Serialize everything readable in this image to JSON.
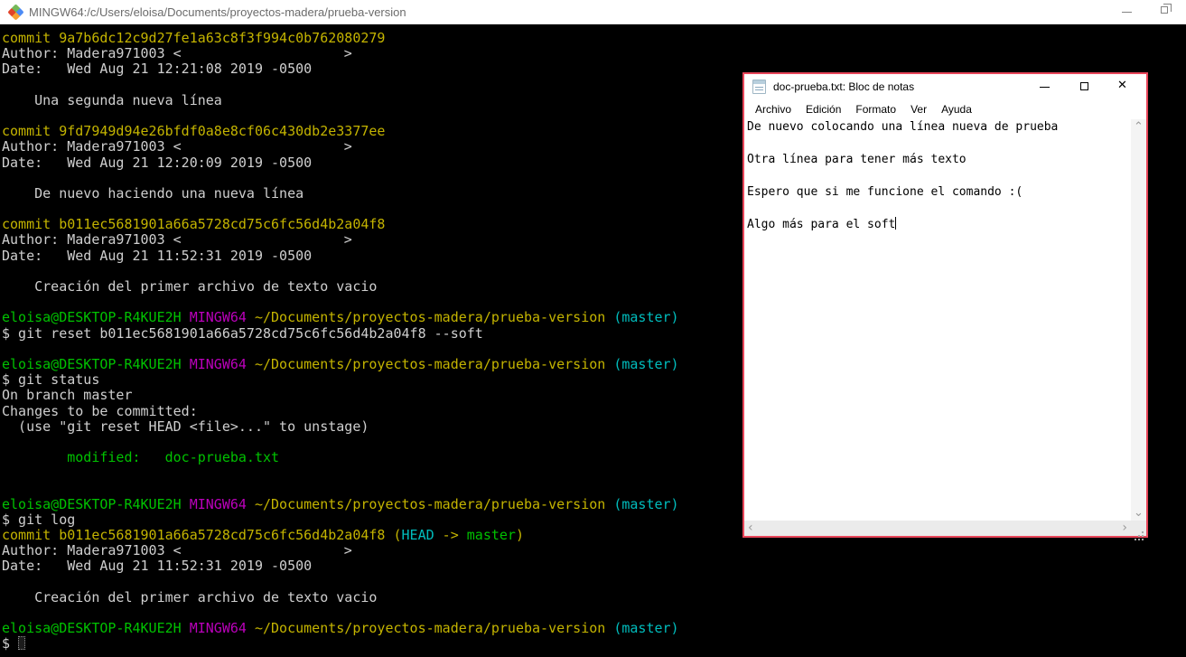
{
  "colors": {
    "terminal_bg": "#000000",
    "terminal_fg": "#cfcfcf",
    "ansi_yellow": "#c4b400",
    "ansi_green": "#00c200",
    "ansi_magenta": "#bb00bb",
    "ansi_cyan": "#00bdbd",
    "notepad_border": "#e8465a",
    "titlebar_bg": "#ffffff"
  },
  "terminal": {
    "title": "MINGW64:/c/Users/eloisa/Documents/proyectos-madera/prueba-version",
    "icons": [
      "git-diamond-icon",
      "minimize-icon",
      "restore-icon"
    ],
    "lines": [
      [
        {
          "t": "commit 9a7b6dc12c9d27fe1a63c8f3f994c0b762080279",
          "c": "y"
        }
      ],
      [
        {
          "t": "Author: Madera971003 <",
          "c": "f"
        },
        {
          "gap": 180
        },
        {
          "t": ">",
          "c": "f"
        }
      ],
      [
        {
          "t": "Date:   Wed Aug 21 12:21:08 2019 -0500",
          "c": "f"
        }
      ],
      [],
      [
        {
          "t": "    Una segunda nueva línea",
          "c": "f"
        }
      ],
      [],
      [
        {
          "t": "commit 9fd7949d94e26bfdf0a8e8cf06c430db2e3377ee",
          "c": "y"
        }
      ],
      [
        {
          "t": "Author: Madera971003 <",
          "c": "f"
        },
        {
          "gap": 180
        },
        {
          "t": ">",
          "c": "f"
        }
      ],
      [
        {
          "t": "Date:   Wed Aug 21 12:20:09 2019 -0500",
          "c": "f"
        }
      ],
      [],
      [
        {
          "t": "    De nuevo haciendo una nueva línea",
          "c": "f"
        }
      ],
      [],
      [
        {
          "t": "commit b011ec5681901a66a5728cd75c6fc56d4b2a04f8",
          "c": "y"
        }
      ],
      [
        {
          "t": "Author: Madera971003 <",
          "c": "f"
        },
        {
          "gap": 180
        },
        {
          "t": ">",
          "c": "f"
        }
      ],
      [
        {
          "t": "Date:   Wed Aug 21 11:52:31 2019 -0500",
          "c": "f"
        }
      ],
      [],
      [
        {
          "t": "    Creación del primer archivo de texto vacio",
          "c": "f"
        }
      ],
      [],
      [
        {
          "t": "eloisa@DESKTOP-R4KUE2H",
          "c": "g"
        },
        {
          "t": " ",
          "c": "f"
        },
        {
          "t": "MINGW64",
          "c": "m"
        },
        {
          "t": " ",
          "c": "f"
        },
        {
          "t": "~/Documents/proyectos-madera/prueba-version",
          "c": "y"
        },
        {
          "t": " ",
          "c": "f"
        },
        {
          "t": "(master)",
          "c": "c"
        }
      ],
      [
        {
          "t": "$ git reset b011ec5681901a66a5728cd75c6fc56d4b2a04f8 --soft",
          "c": "f"
        }
      ],
      [],
      [
        {
          "t": "eloisa@DESKTOP-R4KUE2H",
          "c": "g"
        },
        {
          "t": " ",
          "c": "f"
        },
        {
          "t": "MINGW64",
          "c": "m"
        },
        {
          "t": " ",
          "c": "f"
        },
        {
          "t": "~/Documents/proyectos-madera/prueba-version",
          "c": "y"
        },
        {
          "t": " ",
          "c": "f"
        },
        {
          "t": "(master)",
          "c": "c"
        }
      ],
      [
        {
          "t": "$ git status",
          "c": "f"
        }
      ],
      [
        {
          "t": "On branch master",
          "c": "f"
        }
      ],
      [
        {
          "t": "Changes to be committed:",
          "c": "f"
        }
      ],
      [
        {
          "t": "  (use \"git reset HEAD <file>...\" to unstage)",
          "c": "f"
        }
      ],
      [],
      [
        {
          "t": "        modified:   doc-prueba.txt",
          "c": "g"
        }
      ],
      [],
      [],
      [
        {
          "t": "eloisa@DESKTOP-R4KUE2H",
          "c": "g"
        },
        {
          "t": " ",
          "c": "f"
        },
        {
          "t": "MINGW64",
          "c": "m"
        },
        {
          "t": " ",
          "c": "f"
        },
        {
          "t": "~/Documents/proyectos-madera/prueba-version",
          "c": "y"
        },
        {
          "t": " ",
          "c": "f"
        },
        {
          "t": "(master)",
          "c": "c"
        }
      ],
      [
        {
          "t": "$ git log",
          "c": "f"
        }
      ],
      [
        {
          "t": "commit b011ec5681901a66a5728cd75c6fc56d4b2a04f8 (",
          "c": "y"
        },
        {
          "t": "HEAD",
          "c": "c"
        },
        {
          "t": " -> ",
          "c": "y"
        },
        {
          "t": "master",
          "c": "g"
        },
        {
          "t": ")",
          "c": "y"
        }
      ],
      [
        {
          "t": "Author: Madera971003 <",
          "c": "f"
        },
        {
          "gap": 180
        },
        {
          "t": ">",
          "c": "f"
        }
      ],
      [
        {
          "t": "Date:   Wed Aug 21 11:52:31 2019 -0500",
          "c": "f"
        }
      ],
      [],
      [
        {
          "t": "    Creación del primer archivo de texto vacio",
          "c": "f"
        }
      ],
      [],
      [
        {
          "t": "eloisa@DESKTOP-R4KUE2H",
          "c": "g"
        },
        {
          "t": " ",
          "c": "f"
        },
        {
          "t": "MINGW64",
          "c": "m"
        },
        {
          "t": " ",
          "c": "f"
        },
        {
          "t": "~/Documents/proyectos-madera/prueba-version",
          "c": "y"
        },
        {
          "t": " ",
          "c": "f"
        },
        {
          "t": "(master)",
          "c": "c"
        }
      ],
      [
        {
          "t": "$ ",
          "c": "f"
        },
        {
          "cursor": true
        }
      ]
    ]
  },
  "notepad": {
    "title": "doc-prueba.txt: Bloc de notas",
    "icons": [
      "notepad-icon",
      "minimize-icon",
      "maximize-icon",
      "close-icon"
    ],
    "close_glyph": "✕",
    "menu": [
      "Archivo",
      "Edición",
      "Formato",
      "Ver",
      "Ayuda"
    ],
    "lines": [
      "De nuevo colocando una línea nueva de prueba",
      "",
      "Otra línea para tener más texto",
      "",
      "Espero que si me funcione el comando :(",
      "",
      "Algo más para el soft"
    ],
    "scrollbar": {
      "up": "⌃",
      "down": "⌄",
      "left": "‹",
      "right": "›"
    }
  }
}
